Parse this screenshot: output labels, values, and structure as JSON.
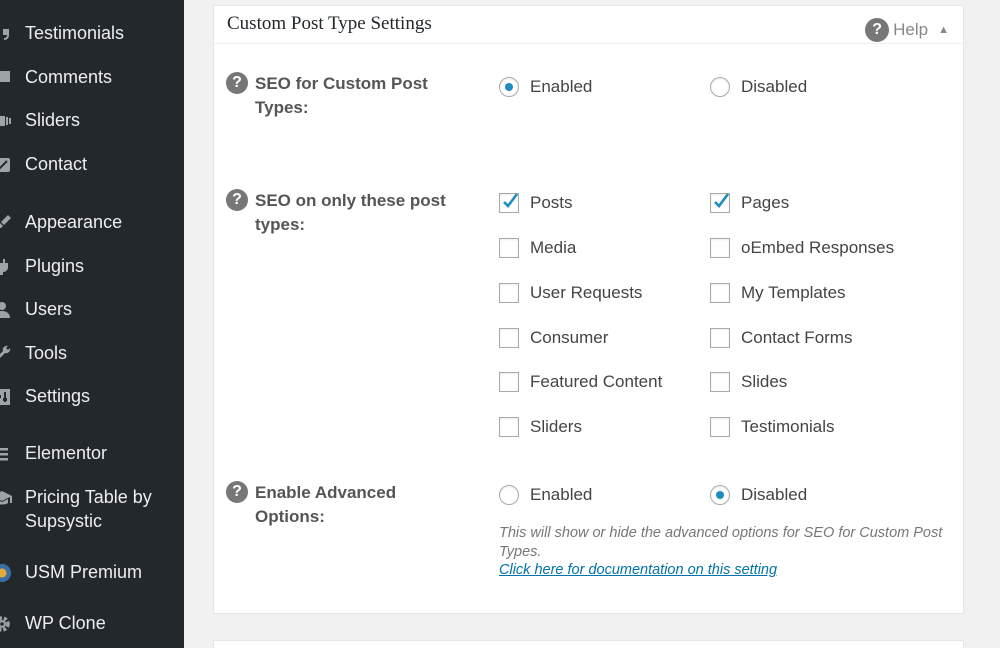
{
  "sidebar": {
    "items": [
      {
        "label": "Testimonials",
        "icon": "quote-icon"
      },
      {
        "label": "Comments",
        "icon": "comment-icon"
      },
      {
        "label": "Sliders",
        "icon": "slides-icon"
      },
      {
        "label": "Contact",
        "icon": "email-icon"
      },
      {
        "label": "Appearance",
        "icon": "paintbrush-icon"
      },
      {
        "label": "Plugins",
        "icon": "plugin-icon"
      },
      {
        "label": "Users",
        "icon": "users-icon"
      },
      {
        "label": "Tools",
        "icon": "wrench-icon"
      },
      {
        "label": "Settings",
        "icon": "settings-icon"
      },
      {
        "label": "Elementor",
        "icon": "elementor-icon"
      },
      {
        "label": "Pricing Table by Supsystic",
        "icon": "graduation-cap-icon"
      },
      {
        "label": "USM Premium",
        "icon": "usm-logo-icon"
      },
      {
        "label": "WP Clone",
        "icon": "gear-icon"
      }
    ]
  },
  "panel": {
    "title": "Custom Post Type Settings",
    "help_label": "Help"
  },
  "settings": {
    "seo_cpt": {
      "label": "SEO for Custom Post Types:",
      "enabled_label": "Enabled",
      "disabled_label": "Disabled",
      "selected": "Enabled"
    },
    "post_types": {
      "label": "SEO on only these post types:",
      "options": [
        {
          "label": "Posts",
          "checked": true
        },
        {
          "label": "Pages",
          "checked": true
        },
        {
          "label": "Media",
          "checked": false
        },
        {
          "label": "oEmbed Responses",
          "checked": false
        },
        {
          "label": "User Requests",
          "checked": false
        },
        {
          "label": "My Templates",
          "checked": false
        },
        {
          "label": "Consumer",
          "checked": false
        },
        {
          "label": "Contact Forms",
          "checked": false
        },
        {
          "label": "Featured Content",
          "checked": false
        },
        {
          "label": "Slides",
          "checked": false
        },
        {
          "label": "Sliders",
          "checked": false
        },
        {
          "label": "Testimonials",
          "checked": false
        }
      ]
    },
    "advanced": {
      "label": "Enable Advanced Options:",
      "enabled_label": "Enabled",
      "disabled_label": "Disabled",
      "selected": "Disabled",
      "note": "This will show or hide the advanced options for SEO for Custom Post Types.",
      "doc_link": "Click here for documentation on this setting"
    }
  },
  "colors": {
    "sidebar_bg": "#23282d",
    "accent": "#1e8cbe",
    "link": "#0073aa"
  }
}
